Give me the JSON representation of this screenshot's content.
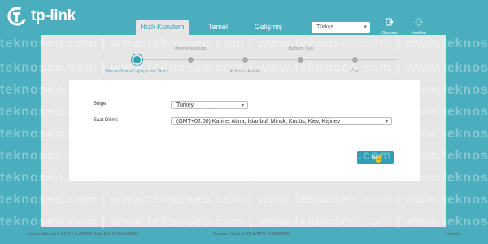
{
  "brand": {
    "name": "tp-link",
    "logo_icon": "tp-link-logo-icon"
  },
  "tabs": [
    {
      "label": "Hızlı Kurulum",
      "active": true
    },
    {
      "label": "Temel",
      "active": false
    },
    {
      "label": "Gelişmiş",
      "active": false
    }
  ],
  "language": {
    "value": "Türkçe",
    "icon": "chevron-down-icon"
  },
  "header_actions": [
    {
      "label": "Oturumu",
      "icon": "logout-icon"
    },
    {
      "label": "Yeniden",
      "icon": "reboot-icon"
    }
  ],
  "steps": [
    {
      "label": "İnternet Servis Sağlayıcınızı Seçin",
      "active": true
    },
    {
      "label": "İnternet Kurulumu",
      "active": false
    },
    {
      "label": "Kablosuz Ayarları",
      "active": false
    },
    {
      "label": "Bağlantı Testi",
      "active": false
    },
    {
      "label": "Özet",
      "active": false
    }
  ],
  "form": {
    "region_label": "Bölge:",
    "region_value": "Turkey",
    "timezone_label": "Saat Dilimi:",
    "timezone_value": "(GMT+02:00) Kahire, Atina, İstanbul, Minsk, Kudüs, Kiev, Kişinev",
    "next_label": "İleri"
  },
  "footer": {
    "firmware": "Yazılım Sürümü:0.1.0 0.9.1 v0088.0 Build 181123 Rel.53886n",
    "hardware": "Donanım Sürümü:TD-W9977 v1 00000000",
    "support": "Destek"
  },
  "watermark": "teknoseo.com | www.teknoseo.com | www.teknoseo.com | www.teknoseo.com",
  "colors": {
    "header_bg": "#4aaebf",
    "accent": "#2f9fb4",
    "panel_bg": "#e6e6e6"
  }
}
